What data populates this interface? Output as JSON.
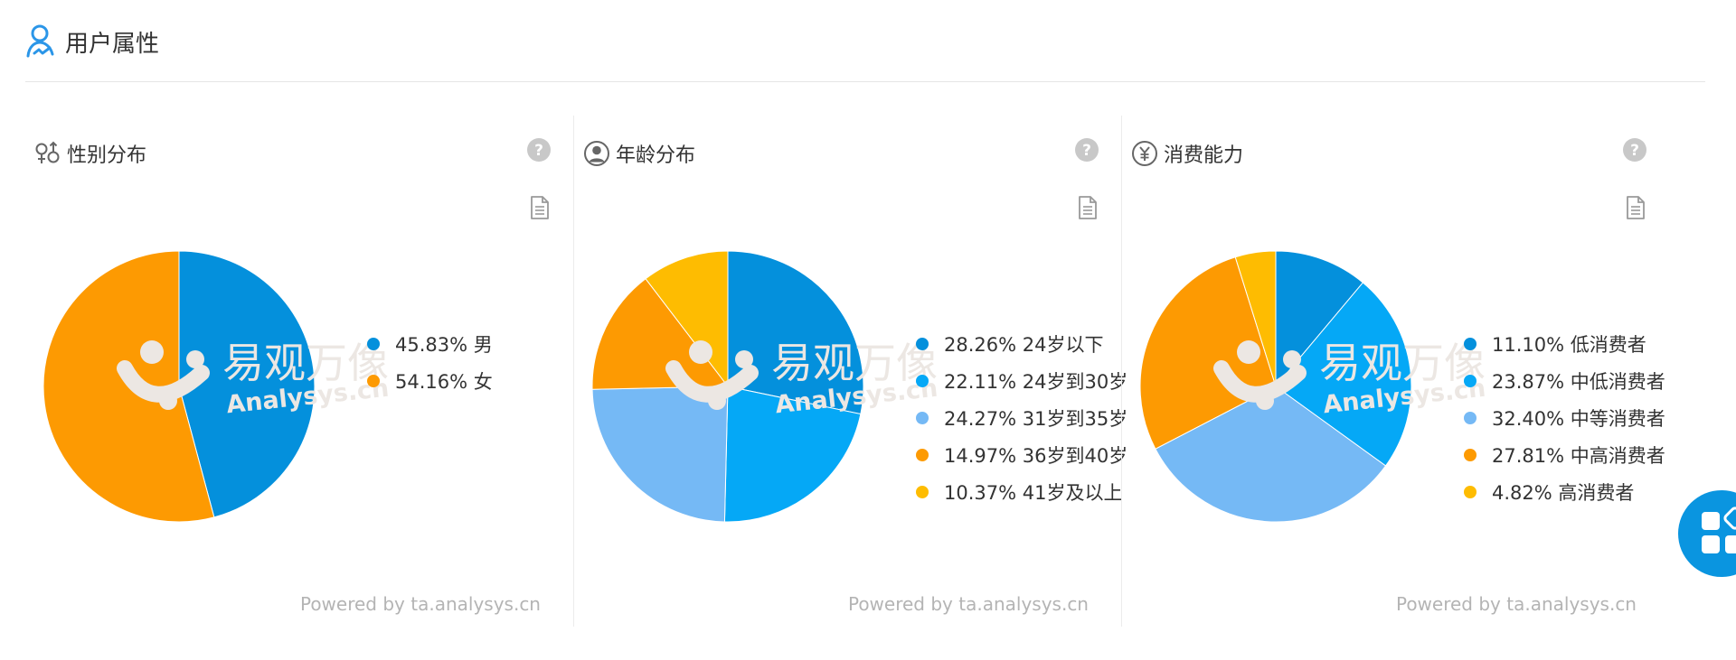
{
  "section": {
    "title": "用户属性"
  },
  "colors": {
    "blue_dark": "#0490dc",
    "blue": "#05a8f6",
    "blue_light": "#75b9f5",
    "orange": "#fd9a02",
    "yellow": "#febc01",
    "fab": "#0a95e0"
  },
  "panels": [
    {
      "title": "性别分布",
      "icon": "gender-icon",
      "powered": "Powered by ta.analysys.cn",
      "watermark": {
        "cn": "易观万像",
        "en": "Analysys.cn"
      },
      "legend": [
        {
          "pct": "45.83%",
          "label": "男"
        },
        {
          "pct": "54.16%",
          "label": "女"
        }
      ]
    },
    {
      "title": "年龄分布",
      "icon": "user-circle-icon",
      "powered": "Powered by ta.analysys.cn",
      "watermark": {
        "cn": "易观万像",
        "en": "Analysys.cn"
      },
      "legend": [
        {
          "pct": "28.26%",
          "label": "24岁以下"
        },
        {
          "pct": "22.11%",
          "label": "24岁到30岁"
        },
        {
          "pct": "24.27%",
          "label": "31岁到35岁"
        },
        {
          "pct": "14.97%",
          "label": "36岁到40岁"
        },
        {
          "pct": "10.37%",
          "label": "41岁及以上"
        }
      ]
    },
    {
      "title": "消费能力",
      "icon": "yen-circle-icon",
      "powered": "Powered by ta.analysys.cn",
      "watermark": {
        "cn": "易观万像",
        "en": "Analysys.cn"
      },
      "legend": [
        {
          "pct": "11.10%",
          "label": "低消费者"
        },
        {
          "pct": "23.87%",
          "label": "中低消费者"
        },
        {
          "pct": "32.40%",
          "label": "中等消费者"
        },
        {
          "pct": "27.81%",
          "label": "中高消费者"
        },
        {
          "pct": "4.82%",
          "label": "高消费者"
        }
      ]
    }
  ],
  "chart_data": [
    {
      "type": "pie",
      "categories": [
        "男",
        "女"
      ],
      "values": [
        45.83,
        54.16
      ],
      "colors": [
        "#0490dc",
        "#fd9a02"
      ],
      "title": "性别分布"
    },
    {
      "type": "pie",
      "categories": [
        "24岁以下",
        "24岁到30岁",
        "31岁到35岁",
        "36岁到40岁",
        "41岁及以上"
      ],
      "values": [
        28.26,
        22.11,
        24.27,
        14.97,
        10.37
      ],
      "colors": [
        "#0490dc",
        "#05a8f6",
        "#75b9f5",
        "#fd9a02",
        "#febc01"
      ],
      "title": "年龄分布"
    },
    {
      "type": "pie",
      "categories": [
        "低消费者",
        "中低消费者",
        "中等消费者",
        "中高消费者",
        "高消费者"
      ],
      "values": [
        11.1,
        23.87,
        32.4,
        27.81,
        4.82
      ],
      "colors": [
        "#0490dc",
        "#05a8f6",
        "#75b9f5",
        "#fd9a02",
        "#febc01"
      ],
      "title": "消费能力"
    }
  ]
}
